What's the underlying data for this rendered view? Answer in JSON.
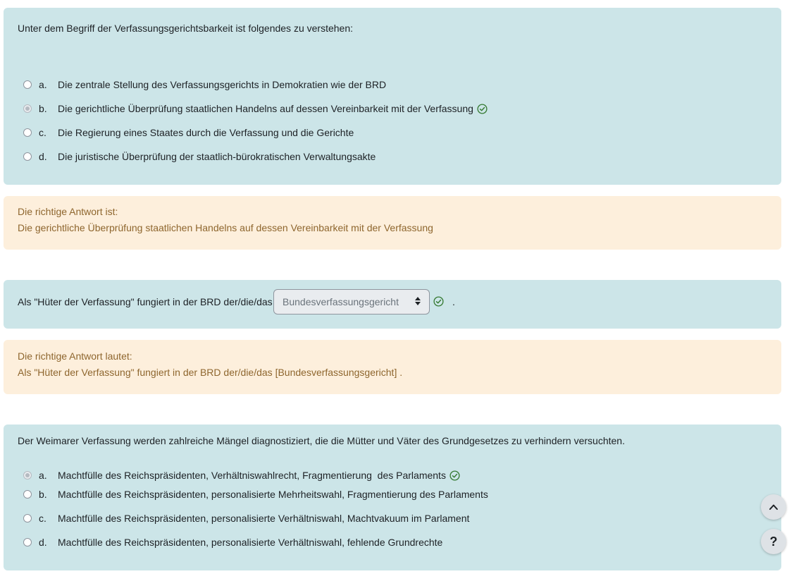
{
  "q1": {
    "text": "Unter dem Begriff der Verfassungsgerichtsbarkeit ist folgendes zu verstehen:",
    "options": [
      {
        "letter": "a.",
        "text": "Die zentrale Stellung des Verfassungsgerichts in Demokratien wie der BRD"
      },
      {
        "letter": "b.",
        "text": "Die gerichtliche Überprüfung staatlichen Handelns auf dessen Vereinbarkeit mit der Verfassung"
      },
      {
        "letter": "c.",
        "text": "Die Regierung eines Staates durch die Verfassung und die Gerichte"
      },
      {
        "letter": "d.",
        "text": "Die juristische Überprüfung der staatlich-bürokratischen Verwaltungsakte"
      }
    ]
  },
  "fb1": {
    "label": "Die richtige Antwort ist:",
    "answer": "Die gerichtliche Überprüfung staatlichen Handelns auf dessen Vereinbarkeit mit der Verfassung"
  },
  "q2": {
    "text_before": "Als \"Hüter der Verfassung\" fungiert in der BRD der/die/das",
    "selected": "Bundesverfassungsgericht",
    "text_after": "."
  },
  "fb2": {
    "label": "Die richtige Antwort lautet:",
    "answer": "Als \"Hüter der Verfassung\" fungiert in der BRD der/die/das [Bundesverfassungsgericht] ."
  },
  "q3": {
    "text": "Der Weimarer Verfassung werden zahlreiche Mängel diagnostiziert, die die Mütter und Väter des Grundgesetzes zu verhindern versuchten.",
    "options": [
      {
        "letter": "a.",
        "text": "Machtfülle des Reichspräsidenten, Verhältniswahlrecht, Fragmentierung  des Parlaments"
      },
      {
        "letter": "b.",
        "text": "Machtfülle des Reichspräsidenten, personalisierte Mehrheitswahl, Fragmentierung des Parlaments"
      },
      {
        "letter": "c.",
        "text": "Machtfülle des Reichspräsidenten, personalisierte Verhältniswahl, Machtvakuum im Parlament"
      },
      {
        "letter": "d.",
        "text": "Machtfülle des Reichspräsidenten, personalisierte Verhältniswahl, fehlende Grundrechte"
      }
    ]
  },
  "ui": {
    "help_label": "?",
    "icons": {
      "correct": "check-circle-icon",
      "scroll_top": "chevron-up-icon",
      "select": "sort-arrows-icon"
    },
    "colors": {
      "question_bg": "#cce5e8",
      "feedback_bg": "#fdefdc",
      "feedback_text": "#8e662e",
      "correct_green": "#357a32"
    }
  }
}
